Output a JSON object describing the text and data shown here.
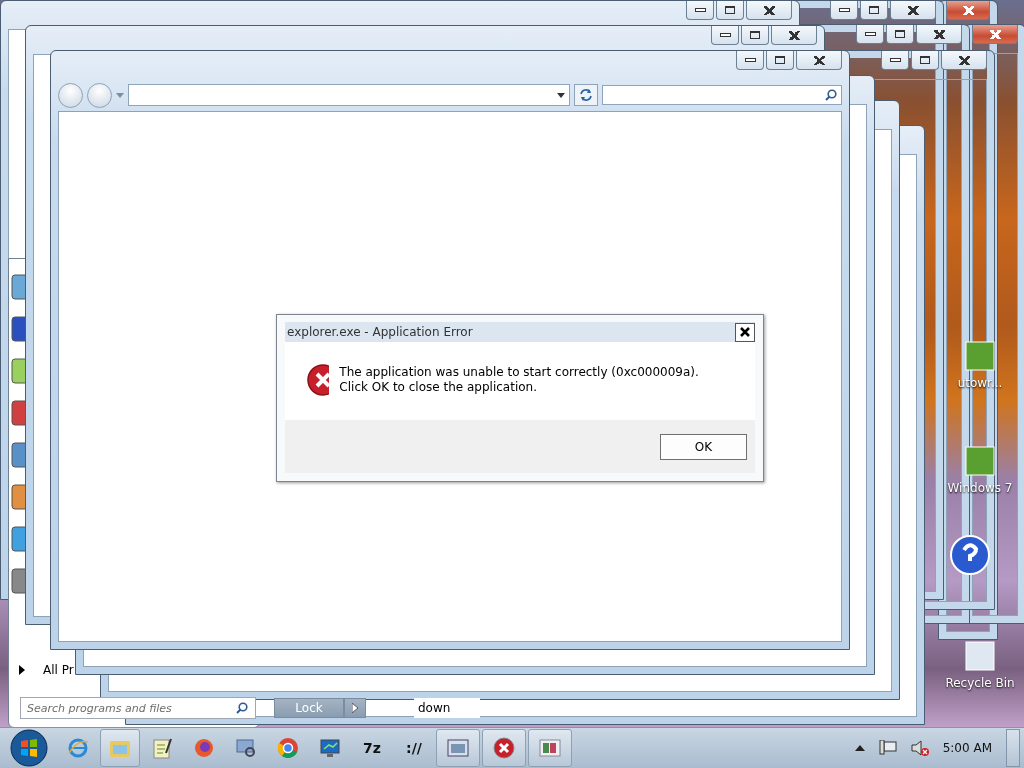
{
  "windows": [
    {
      "active": true
    },
    {
      "active": true
    },
    {
      "active": false
    },
    {
      "active": false
    },
    {
      "active": false
    },
    {
      "active": false
    },
    {
      "active": false
    },
    {
      "active": false
    }
  ],
  "desktop_icons": [
    {
      "label": "utowr..."
    },
    {
      "label": "Windows 7"
    },
    {
      "label": "Recycle Bin"
    }
  ],
  "start_menu": {
    "all_programs": "All Pr",
    "search": {
      "placeholder": "Search programs and files"
    },
    "lock_button": "Lock",
    "shutdown_label": "down"
  },
  "dialog": {
    "title": "explorer.exe - Application Error",
    "message": "The application was unable to start correctly (0xc000009a). Click OK to close the application.",
    "ok_button": "OK"
  },
  "taskbar": {
    "items": [
      {
        "kind": "pinned",
        "running": false
      },
      {
        "kind": "pinned",
        "running": true
      },
      {
        "kind": "pinned",
        "running": false
      },
      {
        "kind": "pinned",
        "running": false
      },
      {
        "kind": "pinned",
        "running": false
      },
      {
        "kind": "pinned",
        "running": false
      },
      {
        "kind": "pinned",
        "running": false
      },
      {
        "kind": "pinned",
        "running": false,
        "label": "7z"
      },
      {
        "kind": "pinned",
        "running": false,
        "label": "://"
      },
      {
        "kind": "app",
        "running": true
      },
      {
        "kind": "app",
        "running": true
      },
      {
        "kind": "app",
        "running": true
      }
    ],
    "clock": "5:00 AM"
  }
}
